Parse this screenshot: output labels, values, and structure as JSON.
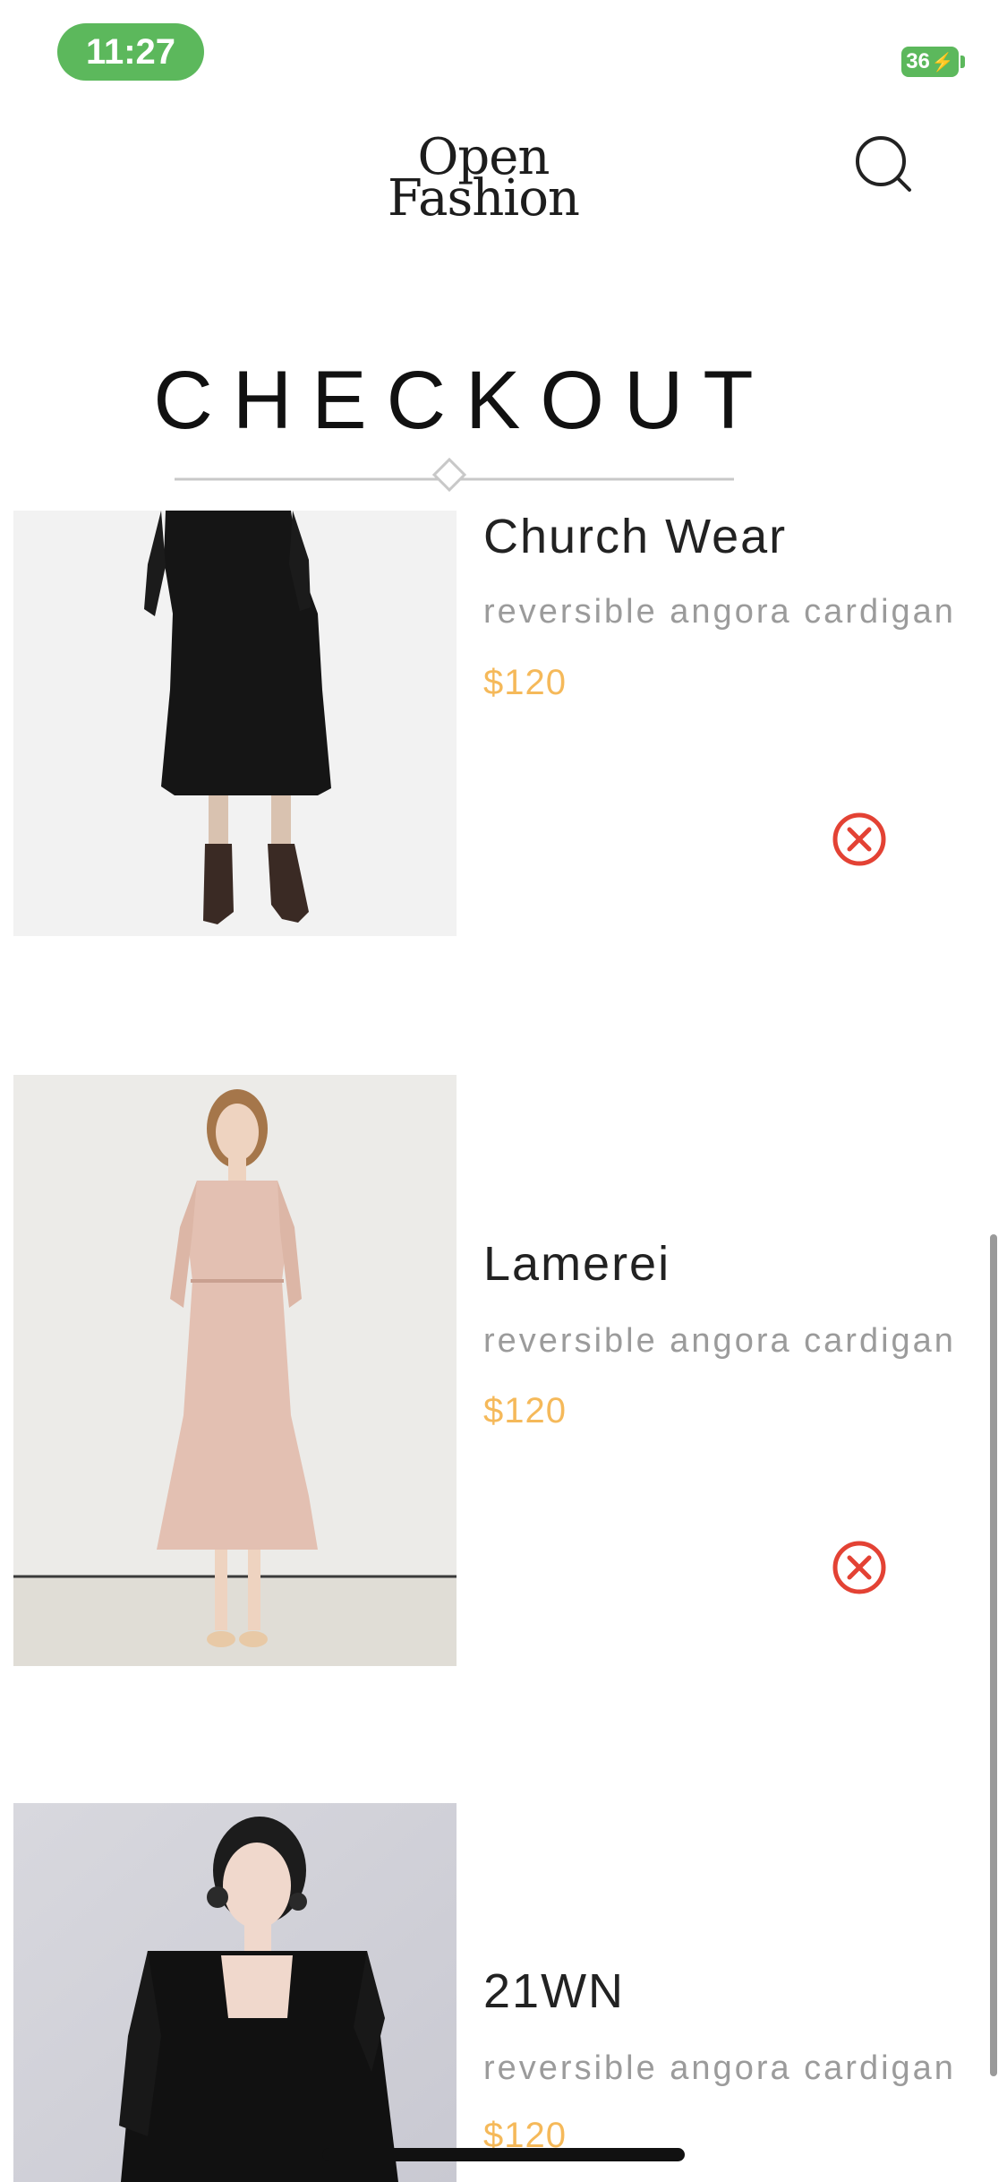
{
  "status_bar": {
    "time": "11:27",
    "battery": "36"
  },
  "header": {
    "logo_line1": "Open",
    "logo_line2": "Fashion",
    "search_icon": "search-icon"
  },
  "page_title": "CHECKOUT",
  "products": [
    {
      "name": "Church Wear",
      "description": "reversible angora cardigan",
      "price": "$120",
      "remove_icon": "close-circle-icon"
    },
    {
      "name": "Lamerei",
      "description": "reversible angora cardigan",
      "price": "$120",
      "remove_icon": "close-circle-icon"
    },
    {
      "name": "21WN",
      "description": "reversible angora cardigan",
      "price": "$120"
    }
  ],
  "colors": {
    "status_green": "#5cb85c",
    "price": "#f5b95a",
    "remove_icon": "#e34234",
    "text_primary": "#222222",
    "text_secondary": "#9b9b9b"
  }
}
